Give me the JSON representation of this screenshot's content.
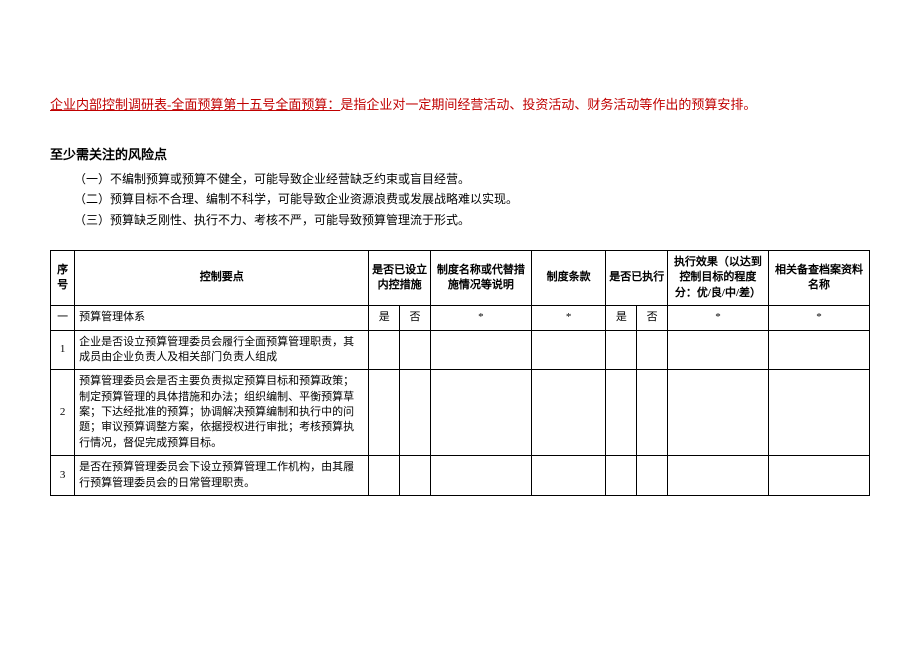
{
  "title": {
    "main": "企业内部控制调研表-全面预算第十五号全面预算：",
    "rest": "是指企业对一定期间经营活动、投资活动、财务活动等作出的预算安排。"
  },
  "risk": {
    "heading": "至少需关注的风险点",
    "items": [
      "（一）不编制预算或预算不健全，可能导致企业经营缺乏约束或盲目经营。",
      "（二）预算目标不合理、编制不科学，可能导致企业资源浪费或发展战略难以实现。",
      "（三）预算缺乏刚性、执行不力、考核不严，可能导致预算管理流于形式。"
    ]
  },
  "headers": {
    "seq": "序号",
    "point": "控制要点",
    "hasControl": "是否已设立内控措施",
    "desc": "制度名称或代替措施情况等说明",
    "clause": "制度条款",
    "executed": "是否已执行",
    "effect": "执行效果（以达到控制目标的程度分：优/良/中/差）",
    "file": "相关备查档案资料名称",
    "yes": "是",
    "no": "否"
  },
  "section": {
    "num": "一",
    "name": "预算管理体系",
    "star": "*"
  },
  "rows": [
    {
      "n": "1",
      "text": "企业是否设立预算管理委员会履行全面预算管理职责，其成员由企业负责人及相关部门负责人组成"
    },
    {
      "n": "2",
      "text": "预算管理委员会是否主要负责拟定预算目标和预算政策；制定预算管理的具体措施和办法；组织编制、平衡预算草案；下达经批准的预算；协调解决预算编制和执行中的问题；审议预算调整方案，依据授权进行审批；考核预算执行情况，督促完成预算目标。"
    },
    {
      "n": "3",
      "text": "是否在预算管理委员会下设立预算管理工作机构，由其履行预算管理委员会的日常管理职责。"
    }
  ]
}
